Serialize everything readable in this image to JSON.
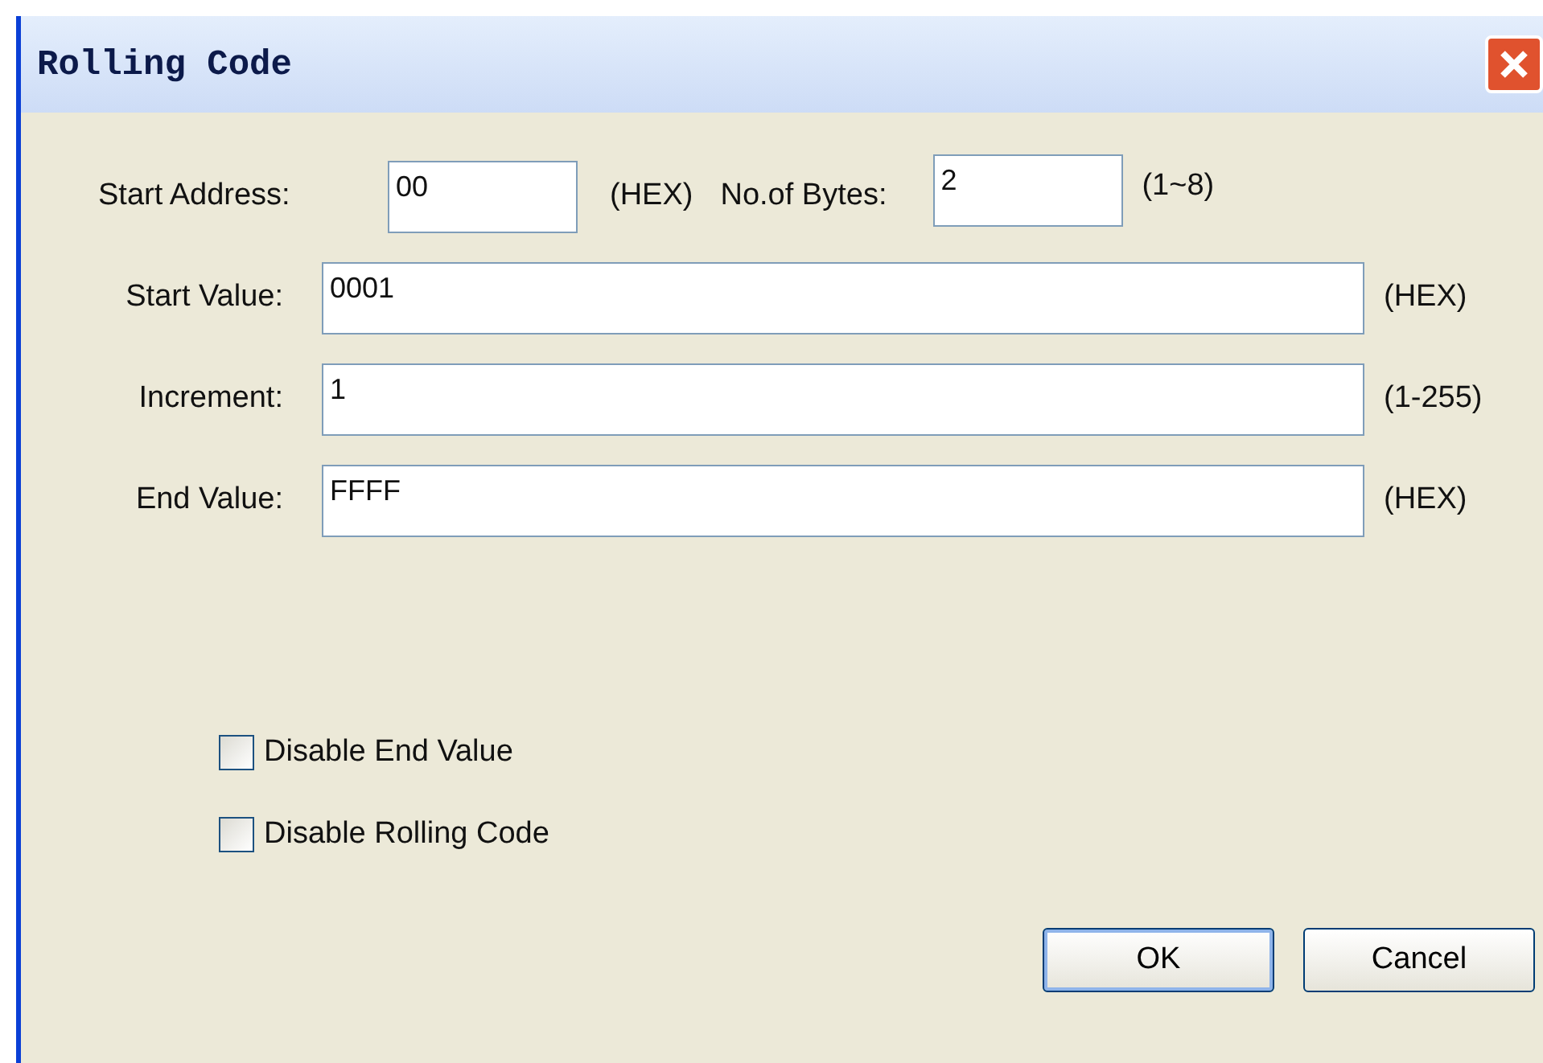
{
  "window": {
    "title": "Rolling Code"
  },
  "top_row": [
    {
      "label": "Start Address:",
      "value": "00",
      "hint": "(HEX)"
    },
    {
      "label": "No.of Bytes:",
      "value": "2",
      "hint": "(1~8)"
    }
  ],
  "fields": [
    {
      "label": "Start Value:",
      "value": "0001",
      "hint": "(HEX)"
    },
    {
      "label": "Increment:",
      "value": "1",
      "hint": "(1-255)"
    },
    {
      "label": "End Value:",
      "value": "FFFF",
      "hint": "(HEX)"
    }
  ],
  "checkboxes": [
    {
      "label": "Disable End Value",
      "checked": false
    },
    {
      "label": "Disable Rolling Code",
      "checked": false
    }
  ],
  "buttons": [
    {
      "label": "OK",
      "focused": true
    },
    {
      "label": "Cancel",
      "focused": false
    }
  ]
}
